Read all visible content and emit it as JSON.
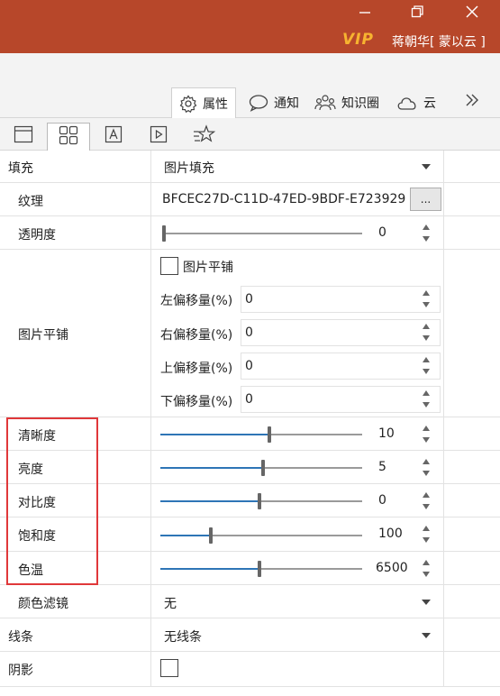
{
  "window": {
    "minimize_icon": "minimize-icon",
    "restore_icon": "restore-icon",
    "close_icon": "close-icon",
    "vip_label": "VIP",
    "user_name": "蒋朝华[ 蒙以云 ]",
    "title_color": "#b7472a"
  },
  "tabs": [
    {
      "label": "属性",
      "icon": "gear-icon",
      "active": true
    },
    {
      "label": "通知",
      "icon": "speech-bubble-icon",
      "active": false
    },
    {
      "label": "知识圈",
      "icon": "people-icon",
      "active": false
    },
    {
      "label": "云",
      "icon": "cloud-icon",
      "active": false
    }
  ],
  "subtabs": [
    {
      "icon": "window-icon",
      "active": false
    },
    {
      "icon": "grid-icon",
      "active": true
    },
    {
      "icon": "text-box-icon",
      "active": false
    },
    {
      "icon": "play-box-icon",
      "active": false
    },
    {
      "icon": "star-effect-icon",
      "active": false
    }
  ],
  "properties": {
    "fill": {
      "label": "填充",
      "value": "图片填充"
    },
    "texture": {
      "label": "纹理",
      "value": "BFCEC27D-C11D-47ED-9BDF-E723929",
      "button": "..."
    },
    "transparency": {
      "label": "透明度",
      "value": "0",
      "level": 0
    },
    "tiling": {
      "label": "图片平铺",
      "checkbox_label": "图片平铺",
      "checked": false,
      "offsets": [
        {
          "label": "左偏移量(%)",
          "value": "0"
        },
        {
          "label": "右偏移量(%)",
          "value": "0"
        },
        {
          "label": "上偏移量(%)",
          "value": "0"
        },
        {
          "label": "下偏移量(%)",
          "value": "0"
        }
      ]
    },
    "sliders": [
      {
        "label": "清晰度",
        "value": "10",
        "level": 0.54
      },
      {
        "label": "亮度",
        "value": "5",
        "level": 0.51
      },
      {
        "label": "对比度",
        "value": "0",
        "level": 0.49
      },
      {
        "label": "饱和度",
        "value": "100",
        "level": 0.25
      },
      {
        "label": "色温",
        "value": "6500",
        "level": 0.49
      }
    ],
    "color_filter": {
      "label": "颜色滤镜",
      "value": "无"
    },
    "line": {
      "label": "线条",
      "value": "无线条"
    },
    "shadow": {
      "label": "阴影",
      "checked": false
    }
  },
  "colors": {
    "slider_fill": "#2e75b6",
    "highlight_border": "#e0383a",
    "vip": "#f7b330"
  }
}
